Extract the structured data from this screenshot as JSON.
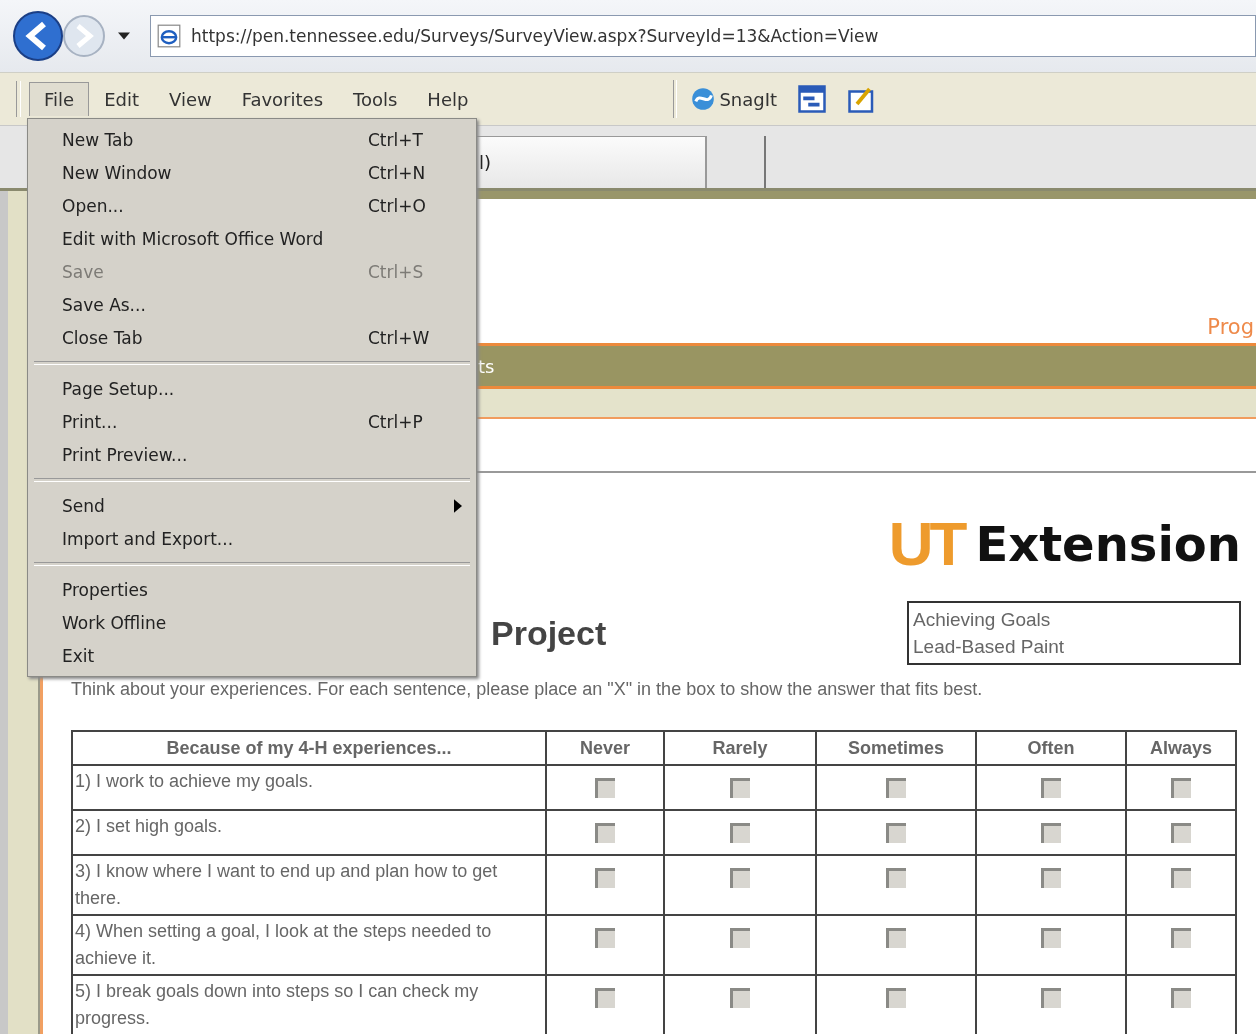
{
  "browser": {
    "address": "https://pen.tennessee.edu/Surveys/SurveyView.aspx?SurveyId=13&Action=View",
    "menus": [
      {
        "label": "File",
        "selected": true
      },
      {
        "label": "Edit",
        "selected": false
      },
      {
        "label": "View",
        "selected": false
      },
      {
        "label": "Favorites",
        "selected": false
      },
      {
        "label": "Tools",
        "selected": false
      },
      {
        "label": "Help",
        "selected": false
      }
    ],
    "toolbar": {
      "snagit": "SnagIt"
    },
    "tab_fragment": "l)"
  },
  "file_menu": {
    "groups": [
      [
        {
          "label": "New Tab",
          "shortcut": "Ctrl+T",
          "disabled": false,
          "submenu": false
        },
        {
          "label": "New Window",
          "shortcut": "Ctrl+N",
          "disabled": false,
          "submenu": false
        },
        {
          "label": "Open...",
          "shortcut": "Ctrl+O",
          "disabled": false,
          "submenu": false
        },
        {
          "label": "Edit with Microsoft Office Word",
          "disabled": false,
          "submenu": false
        },
        {
          "label": "Save",
          "shortcut": "Ctrl+S",
          "disabled": true,
          "submenu": false
        },
        {
          "label": "Save As...",
          "disabled": false,
          "submenu": false
        },
        {
          "label": "Close Tab",
          "shortcut": "Ctrl+W",
          "disabled": false,
          "submenu": false
        }
      ],
      [
        {
          "label": "Page Setup...",
          "disabled": false,
          "submenu": false
        },
        {
          "label": "Print...",
          "shortcut": "Ctrl+P",
          "disabled": false,
          "submenu": false
        },
        {
          "label": "Print Preview...",
          "disabled": false,
          "submenu": false
        }
      ],
      [
        {
          "label": "Send",
          "disabled": false,
          "submenu": true
        },
        {
          "label": "Import and Export...",
          "disabled": false,
          "submenu": false
        }
      ],
      [
        {
          "label": "Properties",
          "disabled": false,
          "submenu": false
        },
        {
          "label": "Work Offline",
          "disabled": false,
          "submenu": false
        },
        {
          "label": "Exit",
          "disabled": false,
          "submenu": false
        }
      ]
    ]
  },
  "page": {
    "header_link": "Prog",
    "nav_fragment": "ts",
    "logo": {
      "mark": "UT",
      "text": "Extension"
    },
    "title_fragment": "Project",
    "project_list": [
      "Achieving Goals",
      "Lead-Based Paint"
    ],
    "instructions": "Think about your experiences. For each sentence, please place an \"X\" in the box to show the answer that fits best.",
    "table": {
      "columns": [
        "Because of my 4-H experiences...",
        "Never",
        "Rarely",
        "Sometimes",
        "Often",
        "Always"
      ],
      "rows": [
        {
          "statement": "1) I work to achieve my goals.",
          "answers": [
            false,
            false,
            false,
            false,
            false
          ]
        },
        {
          "statement": "2) I set high goals.",
          "answers": [
            false,
            false,
            false,
            false,
            false
          ]
        },
        {
          "statement": "3) I know where I want to end up and plan how to get there.",
          "answers": [
            false,
            false,
            false,
            false,
            false
          ]
        },
        {
          "statement": "4) When setting a goal, I look at the steps needed to achieve it.",
          "answers": [
            false,
            false,
            false,
            false,
            false
          ]
        },
        {
          "statement": "5) I break goals down into steps so I can check my progress.",
          "answers": [
            false,
            false,
            false,
            false,
            false
          ]
        }
      ]
    }
  }
}
